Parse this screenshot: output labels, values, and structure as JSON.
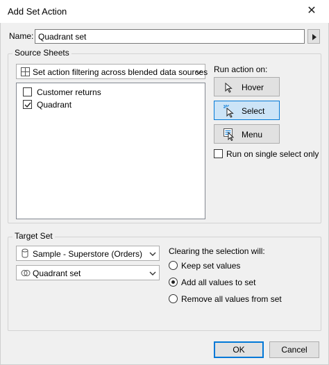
{
  "window": {
    "title": "Add Set Action",
    "close_glyph": "✕"
  },
  "name": {
    "label": "Name:",
    "value": "Quadrant set"
  },
  "source": {
    "legend": "Source Sheets",
    "filter_dropdown": "Set action filtering across blended data sources",
    "sheets": [
      {
        "label": "Customer returns",
        "checked": false
      },
      {
        "label": "Quadrant",
        "checked": true
      }
    ]
  },
  "run_action": {
    "label": "Run action on:",
    "buttons": [
      {
        "label": "Hover",
        "icon": "pointer-icon",
        "selected": false
      },
      {
        "label": "Select",
        "icon": "select-pointer-icon",
        "selected": true
      },
      {
        "label": "Menu",
        "icon": "menu-icon",
        "selected": false
      }
    ],
    "single_select": {
      "label": "Run on single select only",
      "checked": false
    }
  },
  "target": {
    "legend": "Target Set",
    "datasource": "Sample - Superstore (Orders)",
    "set": "Quadrant set",
    "clearing_label": "Clearing the selection will:",
    "options": [
      {
        "label": "Keep set values",
        "selected": false
      },
      {
        "label": "Add all values to set",
        "selected": true
      },
      {
        "label": "Remove all values from set",
        "selected": false
      }
    ]
  },
  "footer": {
    "ok": "OK",
    "cancel": "Cancel"
  },
  "colors": {
    "selected_bg": "#cce4f7",
    "accent": "#0078d7"
  }
}
